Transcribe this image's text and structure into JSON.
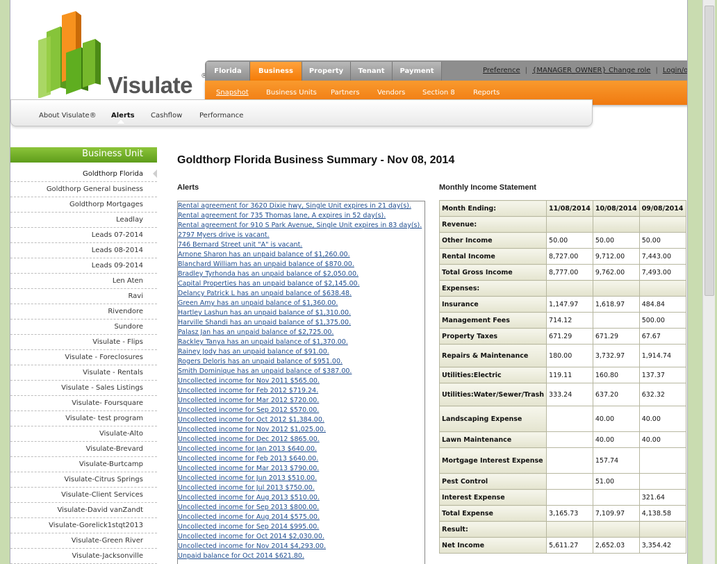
{
  "app": {
    "logo_text": "Visulate",
    "logo_mark": "®"
  },
  "colors": {
    "accent_orange": "#f47c08",
    "accent_green": "#6aa823",
    "link_blue": "#1f4d8f",
    "background": "#c9dcb0"
  },
  "topnav": {
    "tabs": [
      "Florida",
      "Business",
      "Property",
      "Tenant",
      "Payment"
    ],
    "active_tab": "Business",
    "links": [
      "Preference",
      "{MANAGER_OWNER} Change role",
      "Login/out"
    ]
  },
  "subnav": {
    "items": [
      "Snapshot",
      "Business Units",
      "Partners",
      "Vendors",
      "Section 8",
      "Reports"
    ],
    "active": "Snapshot"
  },
  "thirdnav": {
    "items": [
      "About Visulate®",
      "Alerts",
      "Cashflow",
      "Performance"
    ],
    "active": "Alerts"
  },
  "sidebar": {
    "title": "Business Unit",
    "items": [
      "Goldthorp Florida",
      "Goldthorp General business",
      "Goldthorp Mortgages",
      "Leadlay",
      "Leads 07-2014",
      "Leads 08-2014",
      "Leads 09-2014",
      "Len Aten",
      "Ravi",
      "Rivendore",
      "Sundore",
      "Visulate - Flips",
      "Visulate - Foreclosures",
      "Visulate - Rentals",
      "Visulate - Sales Listings",
      "Visulate- Foursquare",
      "Visulate- test program",
      "Visulate-Alto",
      "Visulate-Brevard",
      "Visulate-Burtcamp",
      "Visulate-Citrus Springs",
      "Visulate-Client Services",
      "Visulate-David vanZandt",
      "Visulate-Gorelick1stqt2013",
      "Visulate-Green River",
      "Visulate-Jacksonville"
    ],
    "active": "Goldthorp Florida"
  },
  "main": {
    "title": "Goldthorp Florida Business Summary - Nov 08, 2014",
    "alerts_heading": "Alerts",
    "income_heading": "Monthly Income Statement"
  },
  "alerts": [
    "Rental agreement for 3620 Dixie hwy, Single Unit expires in 21 day(s).",
    "Rental agreement for 735 Thomas lane, A expires in 52 day(s).",
    "Rental agreement for 910 S Park Avenue, Single Unit expires in 83 day(s).",
    "2797 Myers drive is vacant.",
    "746 Bernard Street unit \"A\" is vacant.",
    "Arnone Sharon has an unpaid balance of $1,260.00.",
    "Blanchard William has an unpaid balance of $870.00.",
    "Bradley Tyrhonda has an unpaid balance of $2,050.00.",
    "Capital Properties has an unpaid balance of $2,145.00.",
    "Delancy Patrick L has an unpaid balance of $638.48.",
    "Green Amy has an unpaid balance of $1,360.00.",
    "Hartley Lashun has an unpaid balance of $1,310.00.",
    "Harville Shandi has an unpaid balance of $1,375.00.",
    "Palasz Jan has an unpaid balance of $2,725.00.",
    "Rackley Tanya has an unpaid balance of $1,370.00.",
    "Rainey Jody has an unpaid balance of $91.00.",
    "Rogers Deloris has an unpaid balance of $951.00.",
    "Smith Dominique has an unpaid balance of $387.00.",
    "Uncollected income for Nov 2011 $565.00.",
    "Uncollected income for Feb 2012 $719.24.",
    "Uncollected income for Mar 2012 $720.00.",
    "Uncollected income for Sep 2012 $570.00.",
    "Uncollected income for Oct 2012 $1,384.00.",
    "Uncollected income for Nov 2012 $1,025.00.",
    "Uncollected income for Dec 2012 $865.00.",
    "Uncollected income for Jan 2013 $640.00.",
    "Uncollected income for Feb 2013 $640.00.",
    "Uncollected income for Mar 2013 $790.00.",
    "Uncollected income for Jun 2013 $510.00.",
    "Uncollected income for Jul 2013 $750.00.",
    "Uncollected income for Aug 2013 $510.00.",
    "Uncollected income for Sep 2013 $800.00.",
    "Uncollected income for Aug 2014 $575.00.",
    "Uncollected income for Sep 2014 $995.00.",
    "Uncollected income for Oct 2014 $2,030.00.",
    "Uncollected income for Nov 2014 $4,293.00.",
    "Unpaid balance for Oct 2014 $621.80."
  ],
  "income_statement": {
    "header": [
      "Month Ending:",
      "11/08/2014",
      "10/08/2014",
      "09/08/2014"
    ],
    "rows": [
      {
        "label": "Revenue:",
        "values": [
          "",
          "",
          ""
        ],
        "section": true
      },
      {
        "label": "Other Income",
        "values": [
          "50.00",
          "50.00",
          "50.00"
        ]
      },
      {
        "label": "Rental Income",
        "values": [
          "8,727.00",
          "9,712.00",
          "7,443.00"
        ]
      },
      {
        "label": "Total Gross Income",
        "values": [
          "8,777.00",
          "9,762.00",
          "7,493.00"
        ]
      },
      {
        "label": "Expenses:",
        "values": [
          "",
          "",
          ""
        ],
        "section": true
      },
      {
        "label": "Insurance",
        "values": [
          "1,147.97",
          "1,618.97",
          "484.84"
        ]
      },
      {
        "label": "Management Fees",
        "values": [
          "714.12",
          "",
          "500.00"
        ]
      },
      {
        "label": "Property Taxes",
        "values": [
          "671.29",
          "671.29",
          "67.67"
        ]
      },
      {
        "label": "Repairs & Maintenance",
        "values": [
          "180.00",
          "3,732.97",
          "1,914.74"
        ]
      },
      {
        "label": "Utilities:Electric",
        "values": [
          "119.11",
          "160.80",
          "137.37"
        ]
      },
      {
        "label": "Utilities:Water/Sewer/Trash",
        "values": [
          "333.24",
          "637.20",
          "632.32"
        ]
      },
      {
        "label": "Landscaping Expense",
        "values": [
          "",
          "40.00",
          "40.00"
        ]
      },
      {
        "label": "Lawn Maintenance",
        "values": [
          "",
          "40.00",
          "40.00"
        ]
      },
      {
        "label": "Mortgage Interest Expense",
        "values": [
          "",
          "157.74",
          ""
        ]
      },
      {
        "label": "Pest Control",
        "values": [
          "",
          "51.00",
          ""
        ]
      },
      {
        "label": "Interest Expense",
        "values": [
          "",
          "",
          "321.64"
        ]
      },
      {
        "label": "Total Expense",
        "values": [
          "3,165.73",
          "7,109.97",
          "4,138.58"
        ]
      },
      {
        "label": "Result:",
        "values": [
          "",
          "",
          ""
        ],
        "section": true
      },
      {
        "label": "Net Income",
        "values": [
          "5,611.27",
          "2,652.03",
          "3,354.42"
        ]
      }
    ]
  }
}
